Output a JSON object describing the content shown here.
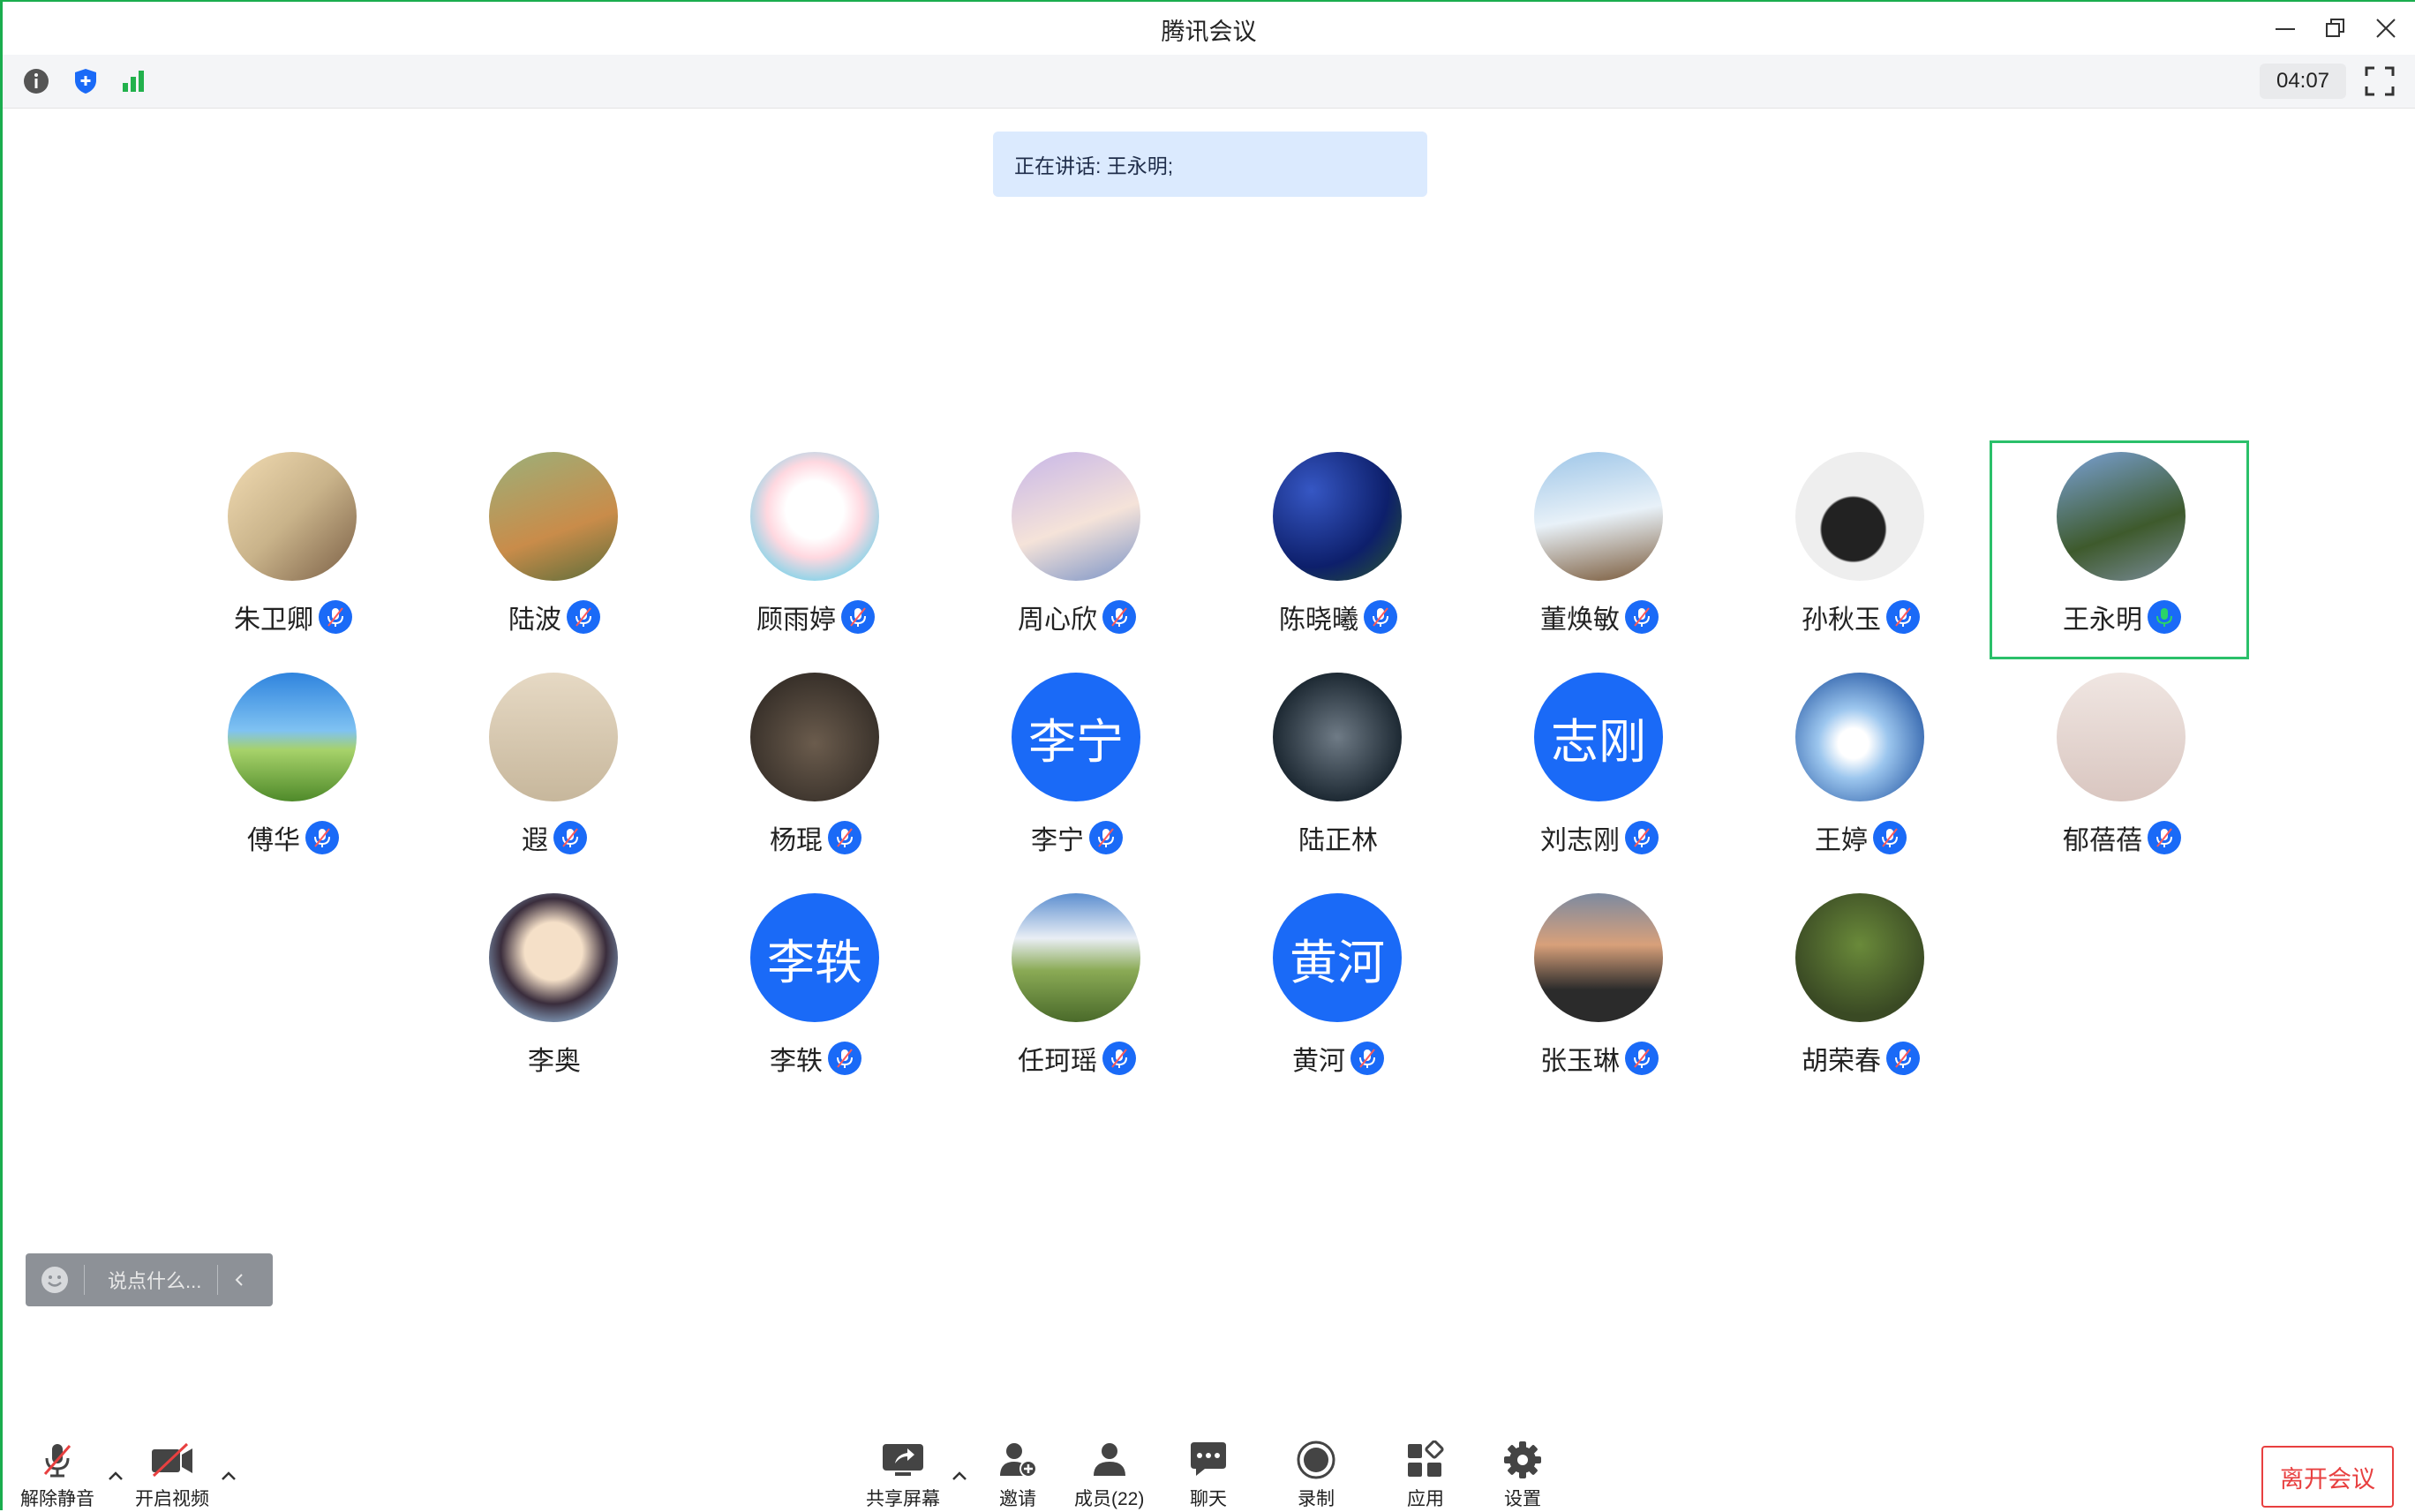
{
  "window": {
    "title": "腾讯会议"
  },
  "infobar": {
    "timer": "04:07"
  },
  "speaking": {
    "text": "正在讲话: 王永明;"
  },
  "colors": {
    "accent": "#1a6af7",
    "frame": "#1aad4e",
    "leave": "#e84040",
    "active_border": "#2bc06a"
  },
  "participants": [
    {
      "name": "朱卫卿",
      "avatar_text": "",
      "mic": "muted"
    },
    {
      "name": "陆波",
      "avatar_text": "",
      "mic": "muted"
    },
    {
      "name": "顾雨婷",
      "avatar_text": "",
      "mic": "muted"
    },
    {
      "name": "周心欣",
      "avatar_text": "",
      "mic": "muted"
    },
    {
      "name": "陈晓曦",
      "avatar_text": "",
      "mic": "muted"
    },
    {
      "name": "董焕敏",
      "avatar_text": "",
      "mic": "muted"
    },
    {
      "name": "孙秋玉",
      "avatar_text": "",
      "mic": "muted"
    },
    {
      "name": "王永明",
      "avatar_text": "",
      "mic": "speaking"
    },
    {
      "name": "傅华",
      "avatar_text": "",
      "mic": "muted"
    },
    {
      "name": "遐",
      "avatar_text": "",
      "mic": "muted"
    },
    {
      "name": "杨琨",
      "avatar_text": "",
      "mic": "muted"
    },
    {
      "name": "李宁",
      "avatar_text": "李宁",
      "mic": "muted"
    },
    {
      "name": "陆正林",
      "avatar_text": "",
      "mic": "none"
    },
    {
      "name": "刘志刚",
      "avatar_text": "志刚",
      "mic": "muted"
    },
    {
      "name": "王婷",
      "avatar_text": "",
      "mic": "muted"
    },
    {
      "name": "郁蓓蓓",
      "avatar_text": "",
      "mic": "muted"
    },
    {
      "name": "李奥",
      "avatar_text": "",
      "mic": "none"
    },
    {
      "name": "李轶",
      "avatar_text": "李轶",
      "mic": "muted"
    },
    {
      "name": "任珂瑶",
      "avatar_text": "",
      "mic": "muted"
    },
    {
      "name": "黄河",
      "avatar_text": "黄河",
      "mic": "muted"
    },
    {
      "name": "张玉琳",
      "avatar_text": "",
      "mic": "muted"
    },
    {
      "name": "胡荣春",
      "avatar_text": "",
      "mic": "muted"
    }
  ],
  "chat": {
    "placeholder": "说点什么..."
  },
  "toolbar": {
    "unmute": "解除静音",
    "start_video": "开启视频",
    "share_screen": "共享屏幕",
    "invite": "邀请",
    "members": "成员(22)",
    "chat": "聊天",
    "record": "录制",
    "apps": "应用",
    "settings": "设置",
    "leave": "离开会议"
  }
}
